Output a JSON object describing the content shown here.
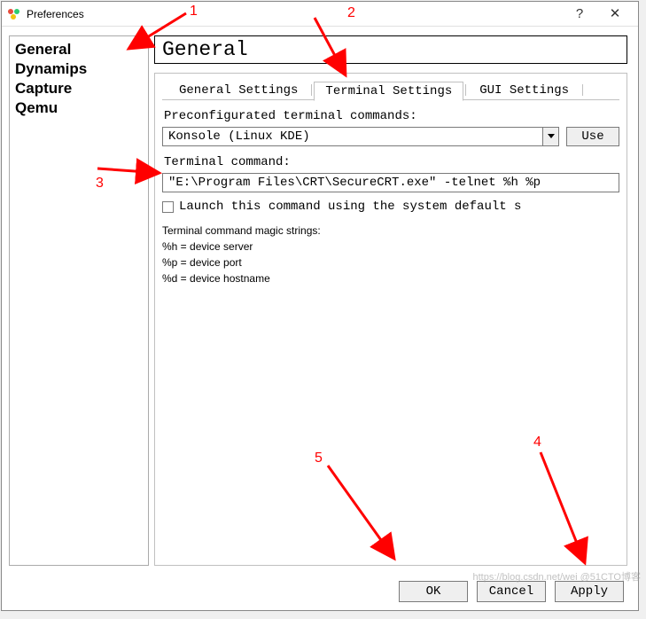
{
  "window": {
    "title": "Preferences"
  },
  "sidebar": {
    "items": [
      {
        "label": "General",
        "selected": true
      },
      {
        "label": "Dynamips",
        "selected": false
      },
      {
        "label": "Capture",
        "selected": false
      },
      {
        "label": "Qemu",
        "selected": false
      }
    ]
  },
  "main": {
    "heading": "General",
    "tabs": [
      {
        "label": "General Settings",
        "active": false
      },
      {
        "label": "Terminal Settings",
        "active": true
      },
      {
        "label": "GUI Settings",
        "active": false
      }
    ],
    "preconfigured_label": "Preconfigurated terminal commands:",
    "combo_value": "Konsole (Linux KDE)",
    "use_label": "Use",
    "command_label": "Terminal command:",
    "command_value": "\"E:\\Program Files\\CRT\\SecureCRT.exe\" -telnet %h %p",
    "launch_label": "Launch this command using the system default s",
    "launch_checked": false,
    "help_heading": "Terminal command magic strings:",
    "help_lines": [
      "%h = device server",
      "%p = device port",
      "%d = device hostname"
    ]
  },
  "footer": {
    "ok": "OK",
    "cancel": "Cancel",
    "apply": "Apply"
  },
  "annotations": {
    "n1": "1",
    "n2": "2",
    "n3": "3",
    "n4": "4",
    "n5": "5"
  },
  "watermark": "https://blog.csdn.net/wei @51CTO博客"
}
